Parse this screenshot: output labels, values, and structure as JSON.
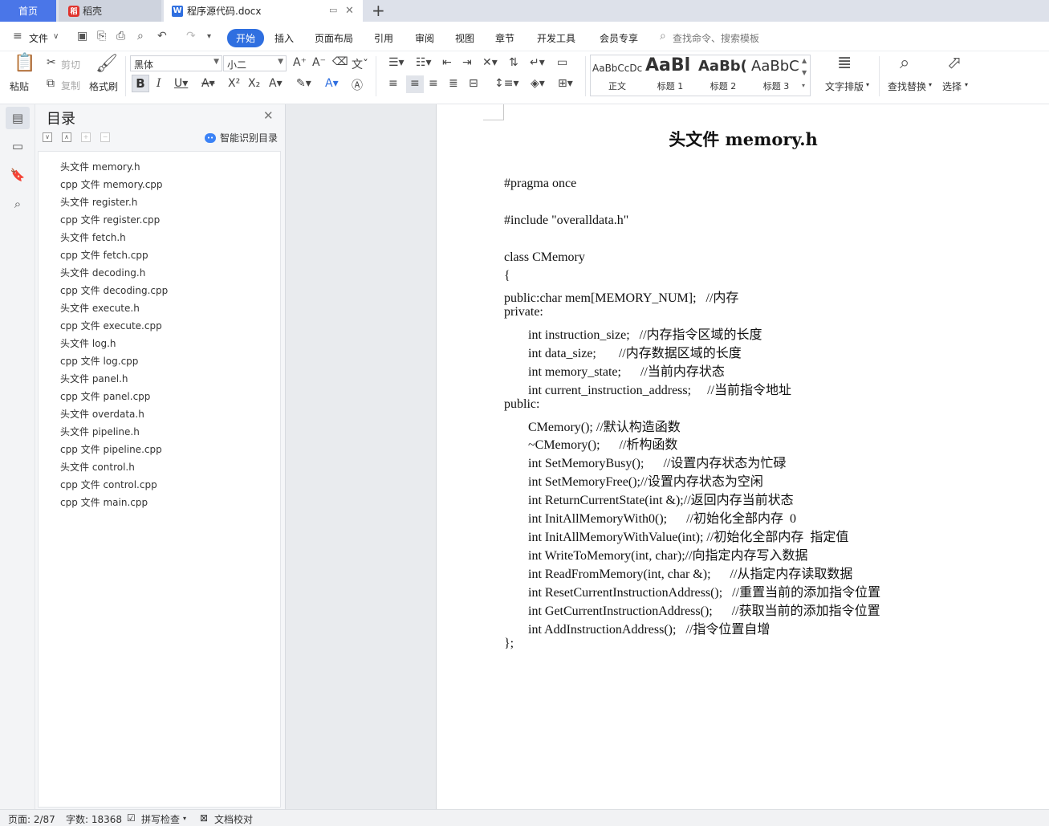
{
  "tabs": {
    "home": "首页",
    "daoke": "稻壳",
    "doc": "程序源代码.docx"
  },
  "menu": {
    "file": "文件",
    "items": [
      "开始",
      "插入",
      "页面布局",
      "引用",
      "审阅",
      "视图",
      "章节",
      "开发工具",
      "会员专享"
    ],
    "search": "查找命令、搜索模板"
  },
  "ribbon": {
    "paste": "粘贴",
    "cut": "剪切",
    "copy": "复制",
    "format_painter": "格式刷",
    "font_name": "黑体",
    "font_size": "小二",
    "styles": [
      {
        "preview": "AaBbCcDc",
        "name": "正文"
      },
      {
        "preview": "AaBl",
        "name": "标题 1"
      },
      {
        "preview": "AaBb(",
        "name": "标题 2"
      },
      {
        "preview": "AaBbC",
        "name": "标题 3"
      }
    ],
    "text_layout": "文字排版",
    "find_replace": "查找替换",
    "select": "选择"
  },
  "toc": {
    "title": "目录",
    "smart": "智能识别目录",
    "items": [
      "头文件  memory.h",
      "cpp 文件  memory.cpp",
      "头文件  register.h",
      "cpp 文件  register.cpp",
      "头文件  fetch.h",
      "cpp 文件  fetch.cpp",
      "头文件  decoding.h",
      "cpp 文件  decoding.cpp",
      "头文件  execute.h",
      "cpp 文件  execute.cpp",
      "头文件  log.h",
      "cpp 文件  log.cpp",
      "头文件  panel.h",
      "cpp 文件  panel.cpp",
      "头文件  overdata.h",
      "头文件  pipeline.h",
      "cpp 文件  pipeline.cpp",
      "头文件  control.h",
      "cpp 文件  control.cpp",
      "cpp 文件  main.cpp"
    ]
  },
  "document": {
    "title": "头文件  memory.h",
    "lines": [
      "#pragma once",
      "",
      "#include \"overalldata.h\"",
      "",
      "class CMemory",
      "{",
      "public:char mem[MEMORY_NUM];   //内存",
      "private:",
      "int instruction_size;   //内存指令区域的长度",
      "int data_size;       //内存数据区域的长度",
      "int memory_state;      //当前内存状态",
      "int current_instruction_address;     //当前指令地址",
      "public:",
      "CMemory(); //默认构造函数",
      "~CMemory();      //析构函数",
      "int SetMemoryBusy();      //设置内存状态为忙碌",
      "int SetMemoryFree();//设置内存状态为空闲",
      "int ReturnCurrentState(int &);//返回内存当前状态",
      "int InitAllMemoryWith0();      //初始化全部内存  0",
      "int InitAllMemoryWithValue(int); //初始化全部内存  指定值",
      "int WriteToMemory(int, char);//向指定内存写入数据",
      "int ReadFromMemory(int, char &);      //从指定内存读取数据",
      "int ResetCurrentInstructionAddress();   //重置当前的添加指令位置",
      "int GetCurrentInstructionAddress();      //获取当前的添加指令位置",
      "int AddInstructionAddress();   //指令位置自增",
      "};"
    ]
  },
  "status": {
    "page": "页面: 2/87",
    "words": "字数: 18368",
    "spell": "拼写检查",
    "proof": "文档校对"
  }
}
